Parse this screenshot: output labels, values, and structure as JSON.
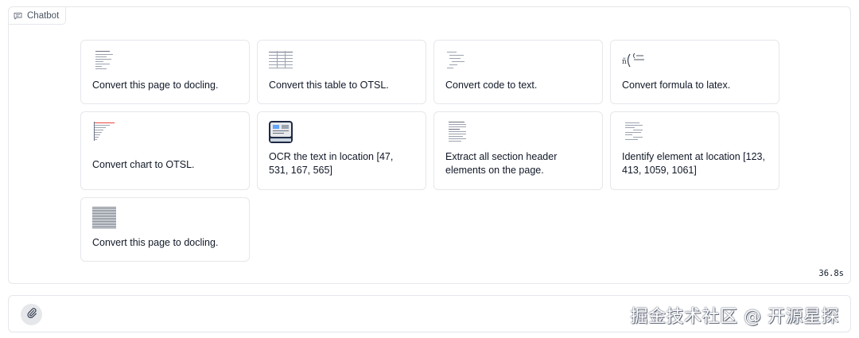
{
  "chatbot": {
    "label": "Chatbot",
    "icon": "chat-icon"
  },
  "examples": [
    {
      "text": "Convert this page to docling.",
      "thumb": "document-page-thumbnail"
    },
    {
      "text": "Convert this table to OTSL.",
      "thumb": "table-thumbnail"
    },
    {
      "text": "Convert code to text.",
      "thumb": "code-thumbnail"
    },
    {
      "text": "Convert formula to latex.",
      "thumb": "formula-thumbnail"
    },
    {
      "text": "Convert chart to OTSL.",
      "thumb": "chart-thumbnail"
    },
    {
      "text": "OCR the text in location [47, 531, 167, 565]",
      "thumb": "ocr-thumbnail"
    },
    {
      "text": "Extract all section header elements on the page.",
      "thumb": "section-header-thumbnail"
    },
    {
      "text": "Identify element at location [123, 413, 1059, 1061]",
      "thumb": "element-location-thumbnail"
    },
    {
      "text": "Convert this page to docling.",
      "thumb": "dense-page-thumbnail"
    }
  ],
  "elapsed_time": "36.8s",
  "input": {
    "attach_icon": "paperclip-icon"
  },
  "watermark": "掘金技术社区 @ 开源星探"
}
